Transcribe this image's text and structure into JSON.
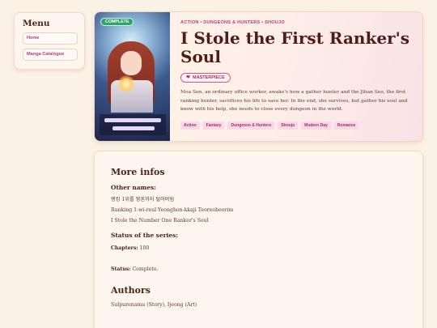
{
  "menu": {
    "title": "Menu",
    "items": [
      {
        "label": "Home"
      },
      {
        "label": "Manga Catalogue"
      }
    ]
  },
  "manga": {
    "status_badge": "COMPLETE",
    "genres_line": "ACTION • DUNGEONS & HUNTERS • SHOUJO",
    "title": "I Stole the First Ranker's Soul",
    "rating_badge": "MASTERPIECE",
    "synopsis": "Moa Son, an ordinary office worker, awake's how a gather hunter and the Jihan Seo, the first ranking hunter, sacrifices his life to save her. In the end, she survives, but gather his soul and know with his help, she needs to close every dungeon in the world.",
    "tags": [
      "Action",
      "Fantasy",
      "Dungeons & Hunters",
      "Shoujo",
      "Modern Day",
      "Romance"
    ]
  },
  "info": {
    "heading": "More infos",
    "other_names_label": "Other names:",
    "other_names": [
      "랭킹 1위를 영혼까지 털어버림",
      "Ranking 1-wi-reul Yeonghon-kkaji Teoreobeorim",
      "I Stole the Number One Ranker's Soul"
    ],
    "status_heading": "Status of the series:",
    "chapters_label": "Chapters:",
    "chapters_value": "100",
    "status_label": "Status:",
    "status_value": "Complete.",
    "authors_heading": "Authors",
    "authors": "Sulpurenamu (Story), Ijeong (Art)"
  },
  "colors": {
    "background": "#fbf1e6",
    "accent": "#c23b72",
    "complete_badge": "#2fa56a"
  }
}
